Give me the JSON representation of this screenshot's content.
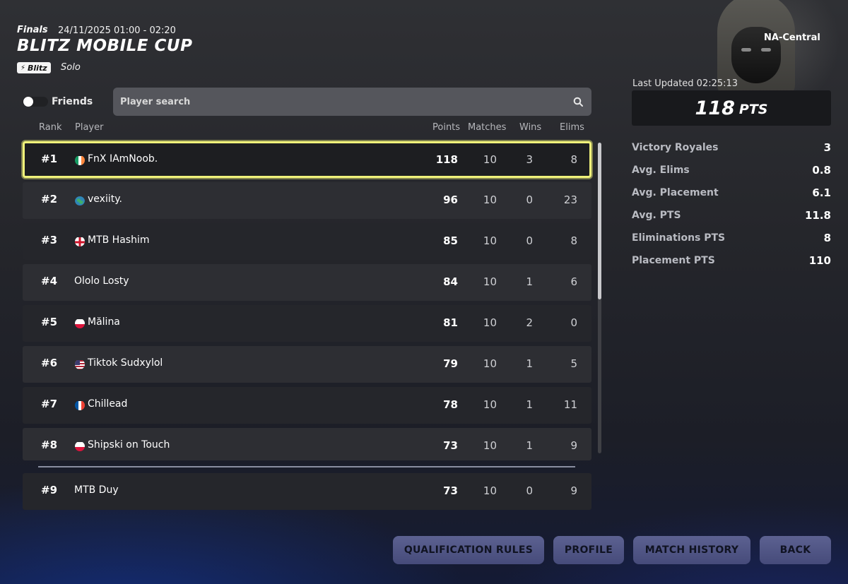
{
  "header": {
    "stage": "Finals",
    "date": "24/11/2025 01:00 - 02:20",
    "title": "BLITZ MOBILE CUP",
    "tag": "Blitz",
    "mode": "Solo",
    "region": "NA-Central"
  },
  "filters": {
    "friends_label": "Friends",
    "search_placeholder": "Player search"
  },
  "columns": {
    "rank": "Rank",
    "player": "Player",
    "points": "Points",
    "matches": "Matches",
    "wins": "Wins",
    "elims": "Elims"
  },
  "rows": [
    {
      "rank": "#1",
      "player": "FnX IAmNoob.",
      "points": "118",
      "matches": "10",
      "wins": "3",
      "elims": "8",
      "flag": "ireland"
    },
    {
      "rank": "#2",
      "player": "vexiity.",
      "points": "96",
      "matches": "10",
      "wins": "0",
      "elims": "23",
      "flag": "globe"
    },
    {
      "rank": "#3",
      "player": "MTB Hashim",
      "points": "85",
      "matches": "10",
      "wins": "0",
      "elims": "8",
      "flag": "england"
    },
    {
      "rank": "#4",
      "player": "Ololo Losty",
      "points": "84",
      "matches": "10",
      "wins": "1",
      "elims": "6",
      "flag": ""
    },
    {
      "rank": "#5",
      "player": "Mălina",
      "points": "81",
      "matches": "10",
      "wins": "2",
      "elims": "0",
      "flag": "poland"
    },
    {
      "rank": "#6",
      "player": "Tiktok Sudxylol",
      "points": "79",
      "matches": "10",
      "wins": "1",
      "elims": "5",
      "flag": "usa"
    },
    {
      "rank": "#7",
      "player": "Chillead",
      "points": "78",
      "matches": "10",
      "wins": "1",
      "elims": "11",
      "flag": "france"
    },
    {
      "rank": "#8",
      "player": "Shipski on Touch",
      "points": "73",
      "matches": "10",
      "wins": "1",
      "elims": "9",
      "flag": "poland"
    },
    {
      "rank": "#9",
      "player": "MTB Duy",
      "points": "73",
      "matches": "10",
      "wins": "0",
      "elims": "9",
      "flag": ""
    }
  ],
  "stats": {
    "last_updated": "Last Updated 02:25:13",
    "total_points": "118",
    "total_unit": "PTS",
    "items": [
      {
        "label": "Victory Royales",
        "value": "3"
      },
      {
        "label": "Avg. Elims",
        "value": "0.8"
      },
      {
        "label": "Avg. Placement",
        "value": "6.1"
      },
      {
        "label": "Avg. PTS",
        "value": "11.8"
      },
      {
        "label": "Eliminations PTS",
        "value": "8"
      },
      {
        "label": "Placement PTS",
        "value": "110"
      }
    ]
  },
  "buttons": {
    "qualification_rules": "QUALIFICATION RULES",
    "profile": "PROFILE",
    "match_history": "MATCH HISTORY",
    "back": "BACK"
  },
  "colors": {
    "selected_outline": "#f0f27a",
    "button_bg": "#525786"
  }
}
